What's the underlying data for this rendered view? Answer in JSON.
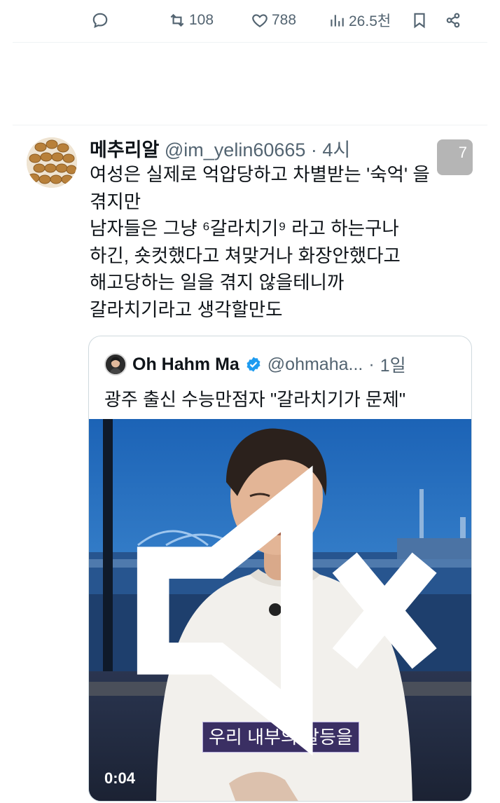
{
  "actions": {
    "retweets": "108",
    "likes": "788",
    "views": "26.5천"
  },
  "tweet": {
    "name": "메추리알",
    "handle": "@im_yelin60665",
    "sep": " · ",
    "time": "4시",
    "lines": [
      "여성은 실제로 억압당하고 차별받는 '숙억' 을",
      "겪지만",
      "남자들은 그냥 ⁶갈라치기⁹ 라고 하는구나",
      "하긴, 숏컷했다고 쳐맞거나 화장안했다고",
      "해고당하는 일을 겪지 않을테니까",
      "갈라치기라고 생각할만도"
    ],
    "image_badge": "7"
  },
  "quote": {
    "name": "Oh Hahm Ma",
    "handle": "@ohmaha...",
    "sep": " · ",
    "time": "1일",
    "text": "광주 출신 수능만점자 \"갈라치기가 문제\"",
    "video": {
      "subtitle": "우리 내부의 갈등을",
      "duration": "0:04"
    }
  },
  "icons": {
    "reply": "reply-icon",
    "retweet": "retweet-icon",
    "like": "heart-icon",
    "views": "views-icon",
    "bookmark": "bookmark-icon",
    "share": "share-icon",
    "verified": "verified-icon",
    "mute": "mute-icon"
  },
  "colors": {
    "secondary_text": "#536471",
    "verified": "#1d9bf0",
    "border": "#cfd9de"
  }
}
